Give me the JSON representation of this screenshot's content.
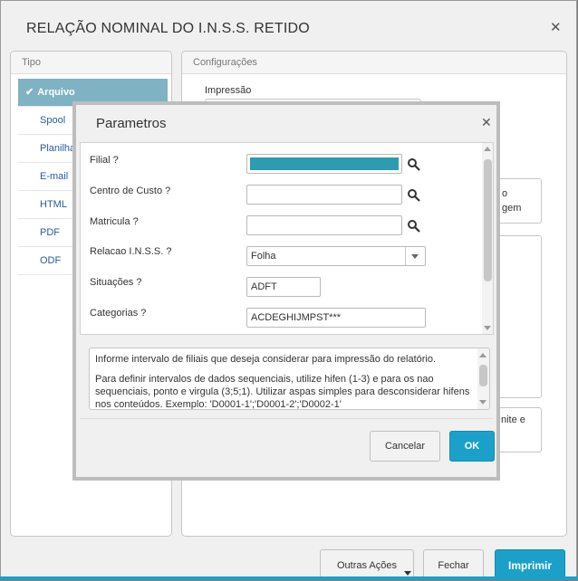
{
  "main": {
    "title": "RELAÇÃO NOMINAL DO I.N.S.S. RETIDO",
    "close_icon": "close-icon"
  },
  "tipo": {
    "header": "Tipo",
    "items": [
      {
        "label": "Arquivo",
        "selected": true
      },
      {
        "label": "Spool"
      },
      {
        "label": "Planilha"
      },
      {
        "label": "E-mail"
      },
      {
        "label": "HTML"
      },
      {
        "label": "PDF"
      },
      {
        "label": "ODF"
      }
    ]
  },
  "config": {
    "header": "Configurações",
    "impressao_label": "Impressão",
    "partial_right_1a": "o",
    "partial_right_1b": "gem",
    "partial_right_2": "nite e"
  },
  "buttons": {
    "outras_acoes": "Outras Ações",
    "fechar": "Fechar",
    "imprimir": "Imprimir"
  },
  "dialog": {
    "title": "Parametros",
    "fields": {
      "filial": {
        "label": "Filial ?",
        "value": ""
      },
      "centro_custo": {
        "label": "Centro de Custo ?",
        "value": ""
      },
      "matricula": {
        "label": "Matricula ?",
        "value": ""
      },
      "relacao_inss": {
        "label": "Relacao I.N.S.S. ?",
        "value": "Folha"
      },
      "situacoes": {
        "label": "Situações ?",
        "value": "ADFT"
      },
      "categorias": {
        "label": "Categorias ?",
        "value": "ACDEGHIJMPST***"
      }
    },
    "help_text_1": "Informe intervalo de filiais que deseja considerar para impressão do relatório.",
    "help_text_2": "Para definir intervalos de dados sequenciais, utilize hifen (1-3) e para os nao sequenciais, ponto e virgula (3;5;1). Utilizar aspas simples para desconsiderar hifens nos conteúdos. Exemplo: 'D0001-1';'D0001-2';'D0002-1'",
    "cancel_label": "Cancelar",
    "ok_label": "OK"
  },
  "colors": {
    "accent": "#1ba1c9",
    "selected_item": "#7fb2c2",
    "filial_fill": "#2d9bb0"
  }
}
